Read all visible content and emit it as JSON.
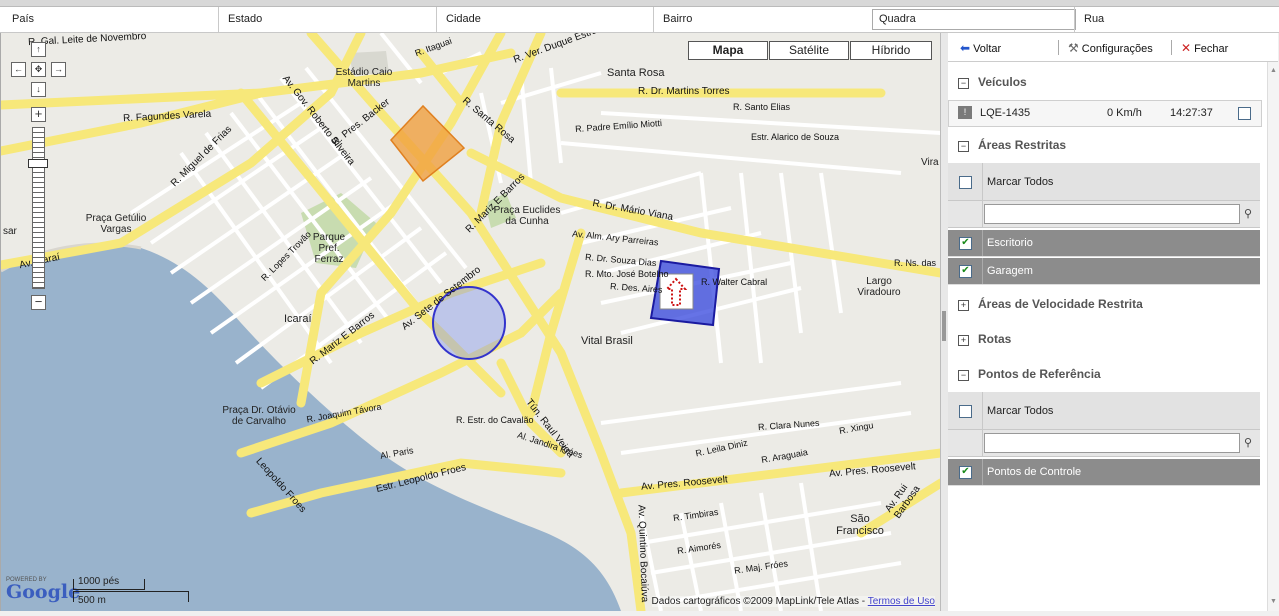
{
  "address_bar": {
    "pais": "País",
    "estado": "Estado",
    "cidade": "Cidade",
    "bairro": "Bairro",
    "quadra": "Quadra",
    "rua": "Rua"
  },
  "map": {
    "types": [
      "Mapa",
      "Satélite",
      "Híbrido"
    ],
    "selected_type": "Mapa",
    "scale_ft": "1000 pés",
    "scale_m": "500 m",
    "powered_by": "POWERED BY",
    "google": "Google",
    "copyright": "Dados cartográficos ©2009 MapLink/Tele Atlas -",
    "terms_link": "Termos de Uso",
    "labels": {
      "l1": "R. Gal. Leite de Novembro",
      "l2": "R. Ver. Duque Estrada",
      "l3": "R. Itaguai",
      "l4": "Estádio Caio Martins",
      "l5": "Santa Rosa",
      "l6": "R. Dr. Martins Torres",
      "l7": "R. Fagundes Varela",
      "l8": "Av. Gov. Roberto Silveira",
      "l9": "R. Pres. Backer",
      "l10": "R. Santa Rosa",
      "l11": "R. Santo Elias",
      "l12": "R. Padre Emílio Miotti",
      "l13": "Estr. Alarico de Souza",
      "l14": "R. Miguel de Frias",
      "l15": "R. Mariz E Barros",
      "l16": "Praça Euclides da Cunha",
      "l17": "Praça Getúlio Vargas",
      "l18": "Parque Pref. Ferraz",
      "l19": "R. Dr. Mário Viana",
      "l20": "Av. Alm. Ary Parreiras",
      "l21": "R. Dr. Souza Dias",
      "l22": "R. Mto. José Botelho",
      "l23": "R. Des. Aires",
      "l24": "R. Walter Cabral",
      "l25": "R. Ns. das",
      "l26": "Largo Viradouro",
      "l27": "Icaraí",
      "l28": "Vital Brasil",
      "l29": "R. Mariz E Barros",
      "l30": "Av. Sete de Setembro",
      "l31": "R. Joaquim Távora",
      "l32": "Praça Dr. Otávio de Carvalho",
      "l33": "Estr. Leopoldo Froes",
      "l34": "Leopoldo Froes",
      "l35": "Tún. Raul Veiga",
      "l36": "Al. Jandira Fróes",
      "l37": "Al. Paris",
      "l38": "Av. Pres. Roosevelt",
      "l39": "Av. Pres. Roosevelt",
      "l40": "São Francisco",
      "l41": "Av. Quintino Bocaiúva",
      "l42": "R. Timbiras",
      "l43": "R. Aimorés",
      "l44": "R. Maj. Fróes",
      "l45": "Av. Rui Barbosa",
      "l46": "R. Clara Nunes",
      "l47": "R. Leila Diniz",
      "l48": "R. Araguaia",
      "l49": "R. Xingu",
      "l50": "R. Lopes Trovão",
      "l51": "Av. Icaraí",
      "l52": "Vira",
      "l53": "sar",
      "l54": "R. Estr. do Cavalão"
    }
  },
  "toolbar": {
    "back": "Voltar",
    "settings": "Configurações",
    "close": "Fechar"
  },
  "sections": {
    "vehicles": {
      "title": "Veículos",
      "toggle": "−",
      "items": [
        {
          "plate": "LQE-1435",
          "speed": "0 Km/h",
          "time": "14:27:37"
        }
      ]
    },
    "restricted_areas": {
      "title": "Áreas Restritas",
      "toggle": "−",
      "mark_all": "Marcar Todos",
      "filter_placeholder": "",
      "items": [
        {
          "name": "Escritorio",
          "checked": true
        },
        {
          "name": "Garagem",
          "checked": true
        }
      ]
    },
    "speed_areas": {
      "title": "Áreas de Velocidade Restrita",
      "toggle": "+"
    },
    "routes": {
      "title": "Rotas",
      "toggle": "+"
    },
    "reference_points": {
      "title": "Pontos de Referência",
      "toggle": "−",
      "mark_all": "Marcar Todos",
      "filter_placeholder": "",
      "items": [
        {
          "name": "Pontos de Controle",
          "checked": true
        }
      ]
    }
  }
}
